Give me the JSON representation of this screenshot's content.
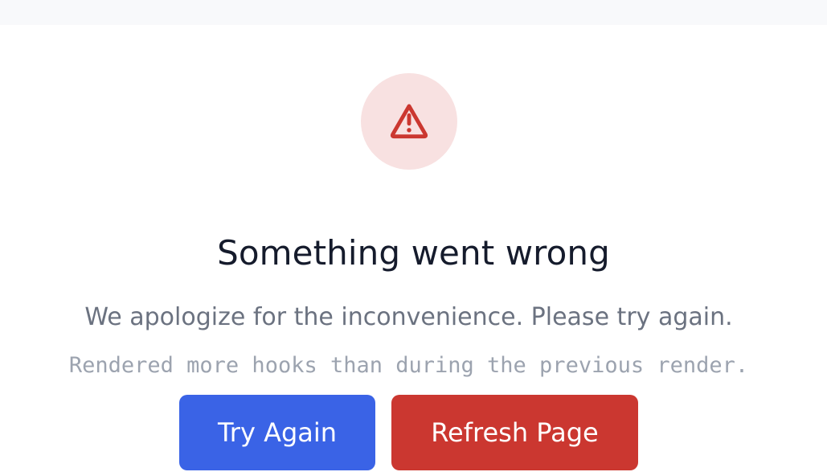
{
  "error": {
    "icon": "warning-triangle-icon",
    "title": "Something went wrong",
    "message": "We apologize for the inconvenience. Please try again.",
    "details": "Rendered more hooks than during the previous render."
  },
  "actions": {
    "try_again_label": "Try Again",
    "refresh_label": "Refresh Page"
  },
  "colors": {
    "top_strip": "#f8f9fb",
    "icon_background": "#f8e1e1",
    "icon": "#cb3730",
    "title": "#151b2c",
    "message": "#6b7280",
    "details": "#9ca3af",
    "try_again": "#3a63e6",
    "refresh": "#cb3730"
  }
}
